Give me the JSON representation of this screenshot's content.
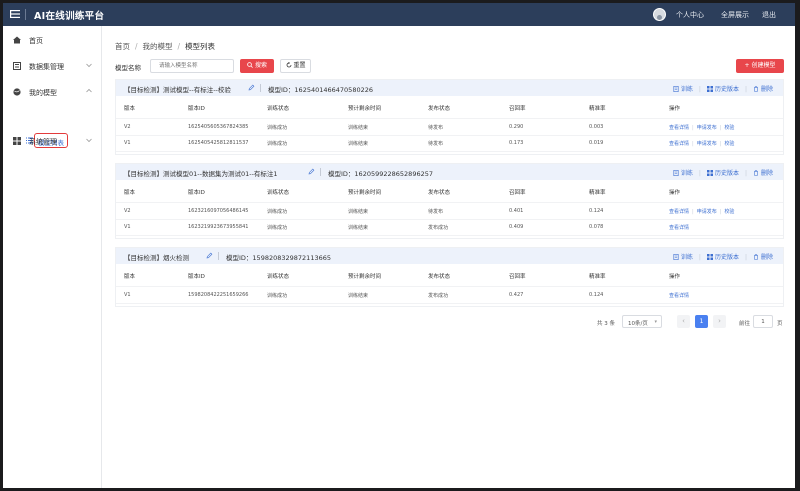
{
  "header": {
    "brand": "AI在线训练平台",
    "user_center": "个人中心",
    "fullscreen": "全屏展示",
    "logout": "退出"
  },
  "sidebar": {
    "items": [
      {
        "label": "首页",
        "icon": "home-icon"
      },
      {
        "label": "数据集管理",
        "icon": "dataset-icon"
      },
      {
        "label": "我的模型",
        "icon": "globe-icon"
      },
      {
        "label": "系统管理",
        "icon": "grid-icon"
      }
    ],
    "sub_item": {
      "label": "模型列表",
      "icon": "list-icon"
    }
  },
  "breadcrumb": [
    "首页",
    "我的模型",
    "模型列表"
  ],
  "filter": {
    "label": "模型名称",
    "placeholder": "请输入模型名称",
    "search_label": "搜索",
    "reset_label": "重置",
    "create_label": "+ 创建模型"
  },
  "columns": [
    "版本",
    "版本ID",
    "训练状态",
    "预计剩余时间",
    "发布状态",
    "召回率",
    "精准率",
    "操作"
  ],
  "card_actions": [
    "训练",
    "历史版本",
    "删除"
  ],
  "models": [
    {
      "title": "【目标检测】测试模型--有标注--校验",
      "id_text": "模型ID：1625401466470580226",
      "rows": [
        {
          "version": "V2",
          "version_id": "1625405605367824385",
          "train_status": "训练成功",
          "remaining": "训练结束",
          "publish_status": "待发布",
          "recall": "0.290",
          "precision": "0.003",
          "ops": [
            "查看详情",
            "申请发布",
            "校验"
          ]
        },
        {
          "version": "V1",
          "version_id": "1625405425812811537",
          "train_status": "训练成功",
          "remaining": "训练结束",
          "publish_status": "待发布",
          "recall": "0.173",
          "precision": "0.019",
          "ops": [
            "查看详情",
            "申请发布",
            "校验"
          ]
        }
      ]
    },
    {
      "title": "【目标检测】测试模型01--数据集为测试01--有标注1",
      "id_text": "模型ID：1620599228652896257",
      "rows": [
        {
          "version": "V2",
          "version_id": "1623216097056486145",
          "train_status": "训练成功",
          "remaining": "训练结束",
          "publish_status": "待发布",
          "recall": "0.401",
          "precision": "0.124",
          "ops": [
            "查看详情",
            "申请发布",
            "校验"
          ]
        },
        {
          "version": "V1",
          "version_id": "1623219923673955841",
          "train_status": "训练成功",
          "remaining": "训练结束",
          "publish_status": "发布成功",
          "recall": "0.409",
          "precision": "0.078",
          "ops": [
            "查看详情"
          ]
        }
      ]
    },
    {
      "title": "【目标检测】烟火检测",
      "id_text": "模型ID：1598208329872113665",
      "rows": [
        {
          "version": "V1",
          "version_id": "1598208422251659266",
          "train_status": "训练成功",
          "remaining": "训练结束",
          "publish_status": "发布成功",
          "recall": "0.427",
          "precision": "0.124",
          "ops": [
            "查看详情"
          ]
        }
      ]
    }
  ],
  "pagination": {
    "total": "共 3 条",
    "page_size": "10条/页",
    "prev": "‹",
    "current": "1",
    "next": "›",
    "goto_label": "前往",
    "goto_value": "1",
    "page_unit": "页"
  }
}
